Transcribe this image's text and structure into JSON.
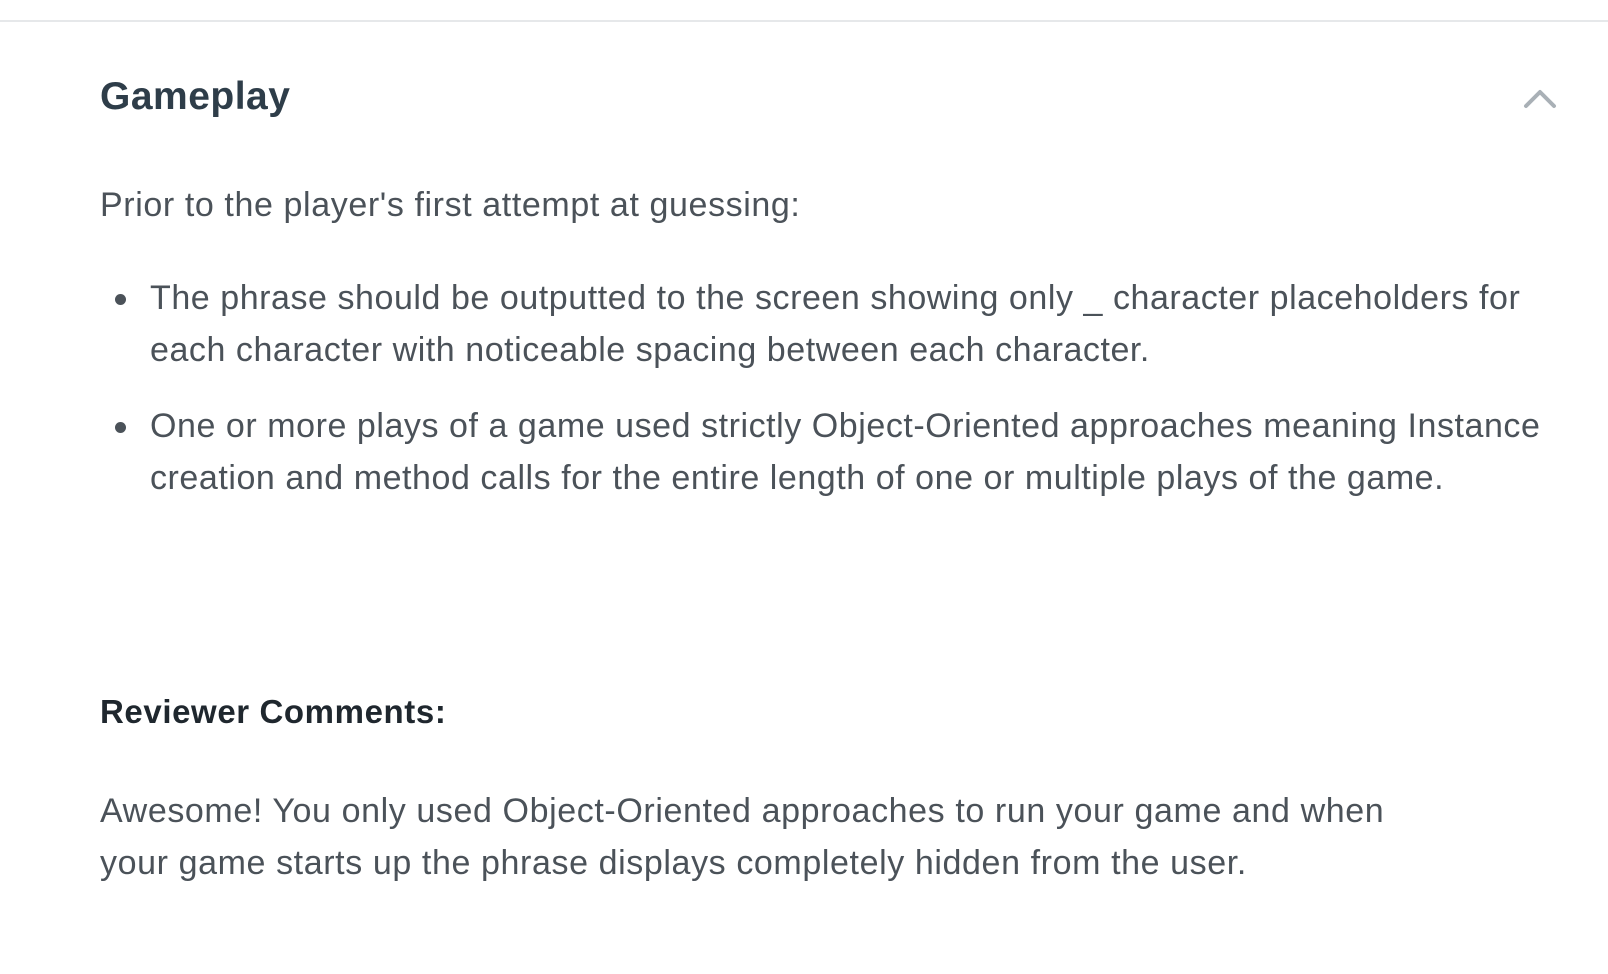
{
  "section": {
    "title": "Gameplay",
    "expanded": true,
    "toggle_icon": "chevron-up-icon"
  },
  "criteria": {
    "intro": "Prior to the player's first attempt at guessing:",
    "items": [
      "The phrase should be outputted to the screen showing only _ character placeholders for each character with noticeable spacing between each character.",
      "One or more plays of a game used strictly Object-Oriented approaches meaning Instance creation and method calls for the entire length of one or multiple plays of the game."
    ]
  },
  "reviewer": {
    "heading": "Reviewer Comments:",
    "comment": "Awesome! You only used Object-Oriented approaches to run your game and when your game starts up the phrase displays completely hidden from the user."
  }
}
